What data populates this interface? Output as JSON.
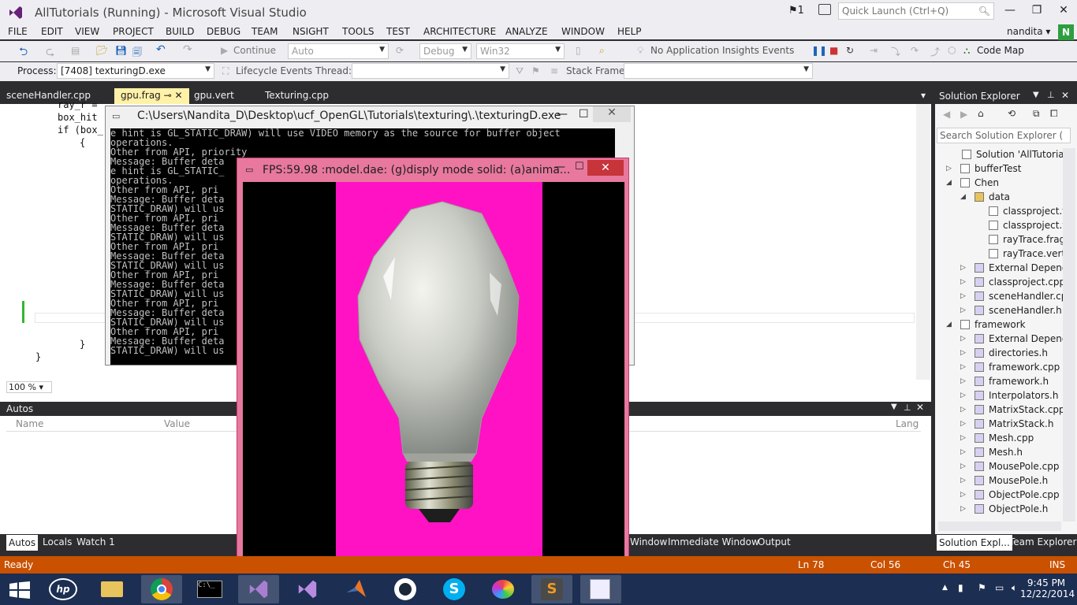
{
  "titlebar": {
    "title": "AllTutorials (Running) - Microsoft Visual Studio",
    "notifications": "1",
    "quick_launch_placeholder": "Quick Launch (Ctrl+Q)"
  },
  "menu": [
    "FILE",
    "EDIT",
    "VIEW",
    "PROJECT",
    "BUILD",
    "DEBUG",
    "TEAM",
    "NSIGHT",
    "TOOLS",
    "TEST",
    "ARCHITECTURE",
    "ANALYZE",
    "WINDOW",
    "HELP"
  ],
  "user": {
    "name": "nandita",
    "initial": "N"
  },
  "toolbar": {
    "continue_label": "Continue",
    "config_auto": "Auto",
    "config_debug": "Debug",
    "platform": "Win32",
    "insights": "No Application Insights Events",
    "code_map": "Code Map"
  },
  "debugbar": {
    "process_label": "Process:",
    "process_value": "[7408] texturingD.exe",
    "lifecycle": "Lifecycle Events",
    "thread_label": "Thread:",
    "stack_label": "Stack Frame:"
  },
  "tabs": [
    "sceneHandler.cpp",
    "gpu.frag",
    "gpu.vert",
    "Texturing.cpp"
  ],
  "active_tab": "gpu.frag",
  "code_lines": [
    "ray_r =",
    "box_hit",
    "if (box_",
    "{",
    "}",
    "}"
  ],
  "zoom": "100 %",
  "console": {
    "title": "C:\\Users\\Nandita_D\\Desktop\\ucf_OpenGL\\Tutorials\\texturing\\.\\texturingD.exe",
    "lines": [
      "e hint is GL_STATIC_DRAW) will use VIDEO memory as the source for buffer object",
      "operations.",
      "Other from API,  priority",
      "Message: Buffer deta",
      "e hint is GL_STATIC_",
      "operations.",
      "Other from API,  pri",
      "Message: Buffer deta",
      "STATIC_DRAW) will us",
      "Other from API,  pri",
      "Message: Buffer deta",
      "STATIC_DRAW) will us",
      "Other from API,  pri",
      "Message: Buffer deta",
      "STATIC_DRAW) will us",
      "Other from API,  pri",
      "Message: Buffer deta",
      "STATIC_DRAW) will us",
      "Other from API,  pri",
      "Message: Buffer deta",
      "STATIC_DRAW) will us",
      "Other from API,  pri",
      "Message: Buffer deta",
      "STATIC_DRAW) will us"
    ]
  },
  "glwindow": {
    "title": "FPS:59.98 :model.dae: (g)disply mode solid: (a)anima..."
  },
  "autos": {
    "title": "Autos",
    "col_name": "Name",
    "col_value": "Value",
    "col_lang": "Lang"
  },
  "bottom_tabs": [
    "Autos",
    "Locals",
    "Watch 1"
  ],
  "bottom_tabs_right": [
    "Window",
    "Immediate Window",
    "Output"
  ],
  "solution_explorer": {
    "title": "Solution Explorer",
    "search_placeholder": "Search Solution Explorer (",
    "items": [
      {
        "label": "Solution 'AllTutorials' (",
        "level": 0,
        "exp": ""
      },
      {
        "label": "bufferTest",
        "level": 1,
        "exp": "▷"
      },
      {
        "label": "Chen",
        "level": 1,
        "exp": "◢"
      },
      {
        "label": "data",
        "level": 2,
        "exp": "◢"
      },
      {
        "label": "classproject.f",
        "level": 3,
        "exp": ""
      },
      {
        "label": "classproject.v",
        "level": 3,
        "exp": ""
      },
      {
        "label": "rayTrace.frag",
        "level": 3,
        "exp": ""
      },
      {
        "label": "rayTrace.vert",
        "level": 3,
        "exp": ""
      },
      {
        "label": "External Depend",
        "level": 2,
        "exp": "▷"
      },
      {
        "label": "classproject.cpp",
        "level": 2,
        "exp": "▷"
      },
      {
        "label": "sceneHandler.cp",
        "level": 2,
        "exp": "▷"
      },
      {
        "label": "sceneHandler.h",
        "level": 2,
        "exp": "▷"
      },
      {
        "label": "framework",
        "level": 1,
        "exp": "◢"
      },
      {
        "label": "External Depend",
        "level": 2,
        "exp": "▷"
      },
      {
        "label": "directories.h",
        "level": 2,
        "exp": "▷"
      },
      {
        "label": "framework.cpp",
        "level": 2,
        "exp": "▷"
      },
      {
        "label": "framework.h",
        "level": 2,
        "exp": "▷"
      },
      {
        "label": "Interpolators.h",
        "level": 2,
        "exp": "▷"
      },
      {
        "label": "MatrixStack.cpp",
        "level": 2,
        "exp": "▷"
      },
      {
        "label": "MatrixStack.h",
        "level": 2,
        "exp": "▷"
      },
      {
        "label": "Mesh.cpp",
        "level": 2,
        "exp": "▷"
      },
      {
        "label": "Mesh.h",
        "level": 2,
        "exp": "▷"
      },
      {
        "label": "MousePole.cpp",
        "level": 2,
        "exp": "▷"
      },
      {
        "label": "MousePole.h",
        "level": 2,
        "exp": "▷"
      },
      {
        "label": "ObjectPole.cpp",
        "level": 2,
        "exp": "▷"
      },
      {
        "label": "ObjectPole.h",
        "level": 2,
        "exp": "▷"
      }
    ],
    "tab_left": "Solution Expl...",
    "tab_right": "Team Explorer"
  },
  "status": {
    "ready": "Ready",
    "ln": "Ln 78",
    "col": "Col 56",
    "ch": "Ch 45",
    "ins": "INS"
  },
  "clock": {
    "time": "9:45 PM",
    "date": "12/22/2014"
  },
  "colors": {
    "status_bar": "#ca5100",
    "gl_background": "#ff12c4",
    "vs_purple": "#68217a"
  }
}
